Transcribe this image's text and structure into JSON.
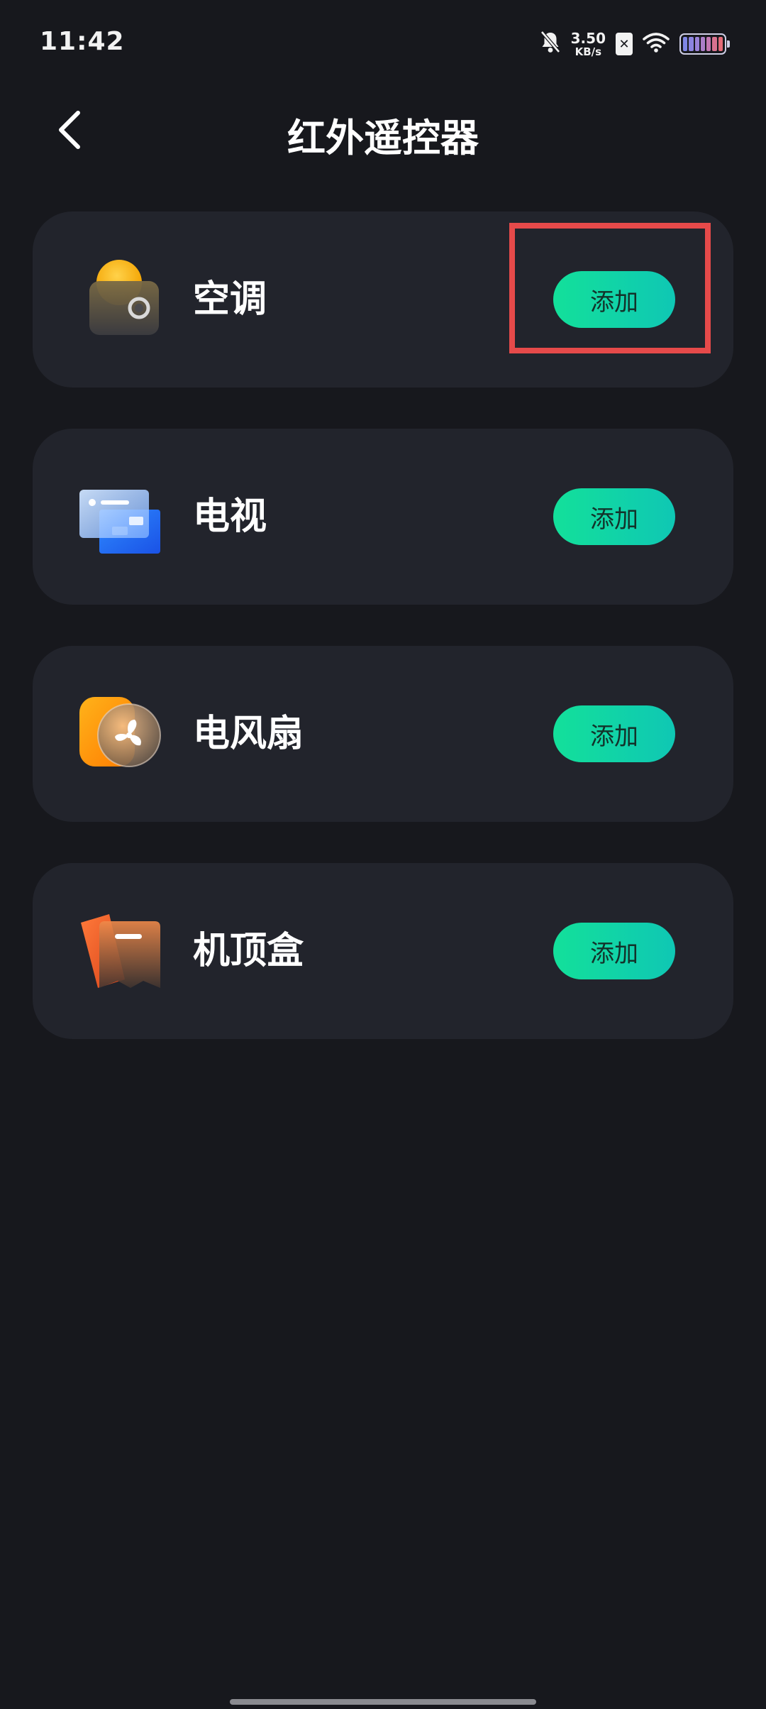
{
  "status_bar": {
    "time": "11:42",
    "net_speed_value": "3.50",
    "net_speed_unit": "KB/s",
    "sim_badge": "✕",
    "icons": [
      "bell-off-icon",
      "sim-disabled-icon",
      "wifi-icon",
      "battery-icon"
    ]
  },
  "header": {
    "title": "红外遥控器",
    "back_icon": "chevron-left-icon"
  },
  "devices": [
    {
      "label": "空调",
      "button": "添加",
      "icon": "air-conditioner-icon"
    },
    {
      "label": "电视",
      "button": "添加",
      "icon": "tv-icon"
    },
    {
      "label": "电风扇",
      "button": "添加",
      "icon": "electric-fan-icon"
    },
    {
      "label": "机顶盒",
      "button": "添加",
      "icon": "set-top-box-icon"
    }
  ],
  "colors": {
    "background": "#17181d",
    "card": "#22242c",
    "accent_start": "#13e09a",
    "accent_end": "#0fc7b4",
    "highlight": "#e64a4a"
  }
}
